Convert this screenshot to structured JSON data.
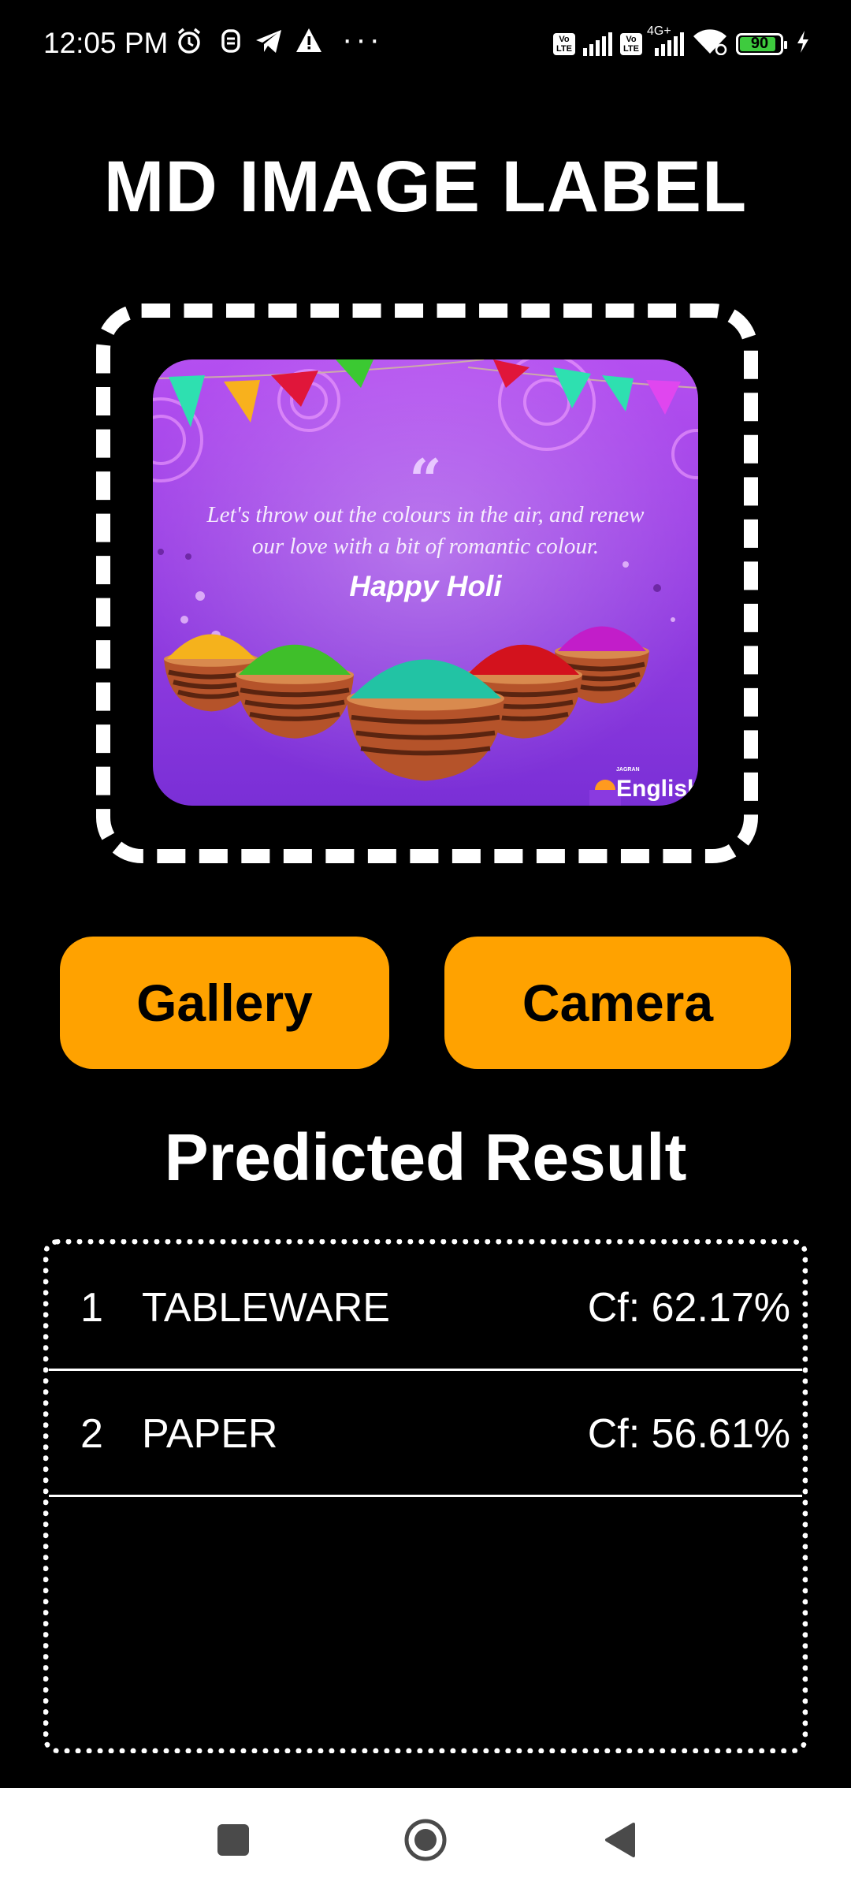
{
  "status_bar": {
    "time": "12:05 PM",
    "notification_icons": [
      "alarm-icon",
      "face-icon",
      "telegram-icon",
      "warning-icon"
    ],
    "overflow": "···",
    "sim1_tag": "Vo LTE",
    "sim2_tag": "Vo LTE",
    "network_type": "4G+",
    "battery_percent": "90",
    "battery_level": 0.9,
    "charging": true
  },
  "app": {
    "title": "MD IMAGE LABEL"
  },
  "preview_image": {
    "quote": "Let's throw out the colours in the air, and renew our love with a bit of romantic colour.",
    "quote_line1": "Let's throw out the colours in the air, and renew",
    "quote_line2": "our love with a bit of romantic colour.",
    "greeting": "Happy Holi",
    "brand_small": "JAGRAN",
    "brand": "English",
    "colors": {
      "background_top": "#b44ff0",
      "background_bottom": "#7a2fd6",
      "powder": [
        "#f5b21c",
        "#3fbf2a",
        "#22c3a4",
        "#d3121d",
        "#c21dc9"
      ],
      "bowl": "#b5532a"
    }
  },
  "buttons": {
    "gallery": "Gallery",
    "camera": "Camera"
  },
  "results": {
    "title": "Predicted Result",
    "items": [
      {
        "index": "1",
        "label": "TABLEWARE",
        "confidence": "Cf: 62.17%"
      },
      {
        "index": "2",
        "label": "PAPER",
        "confidence": "Cf: 56.61%"
      }
    ]
  },
  "colors": {
    "accent": "#ffa200",
    "background": "#000000",
    "text": "#ffffff"
  }
}
